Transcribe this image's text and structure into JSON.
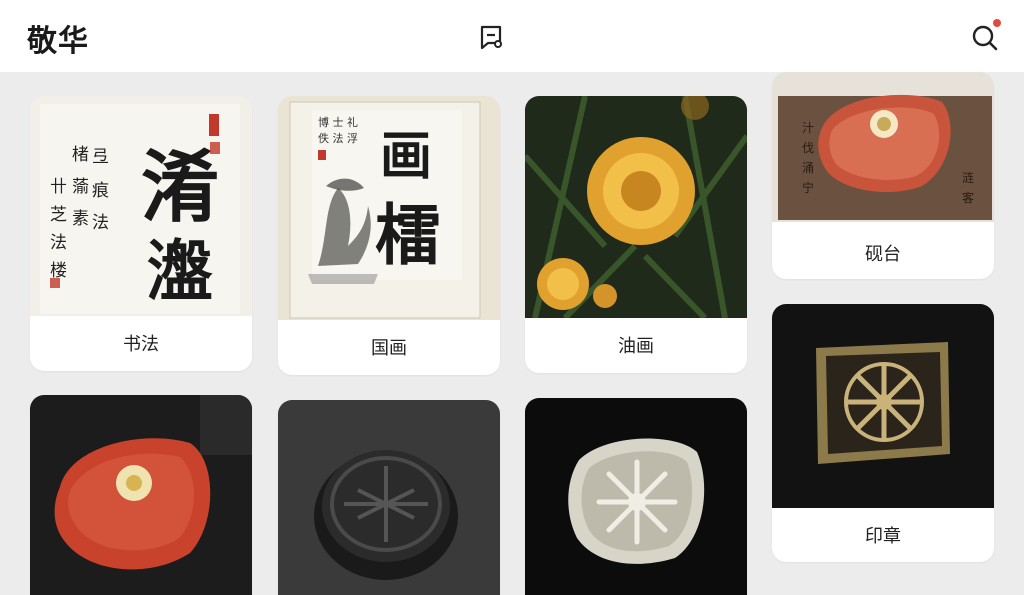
{
  "header": {
    "title": "敬华",
    "center_icon": "chat-bubble-icon",
    "search_icon": "search-icon",
    "notification_color": "#e24a3f"
  },
  "categories": [
    {
      "label": "书法"
    },
    {
      "label": "国画"
    },
    {
      "label": "油画"
    },
    {
      "label": "砚台"
    },
    {
      "label": "印章"
    }
  ],
  "calligraphy_text": {
    "main_chars_top": "淆",
    "main_chars_bottom": "瀊",
    "side_text": "楮 弖 蕍 痕 素 法 卄 芝 法 楼",
    "painting_chars_top": "画",
    "painting_chars_bottom": "檑",
    "painting_side": "博 士 礼 佚 法 浮"
  },
  "colors": {
    "background": "#ececec",
    "card": "#ffffff",
    "accent_red": "#e24a3f"
  }
}
